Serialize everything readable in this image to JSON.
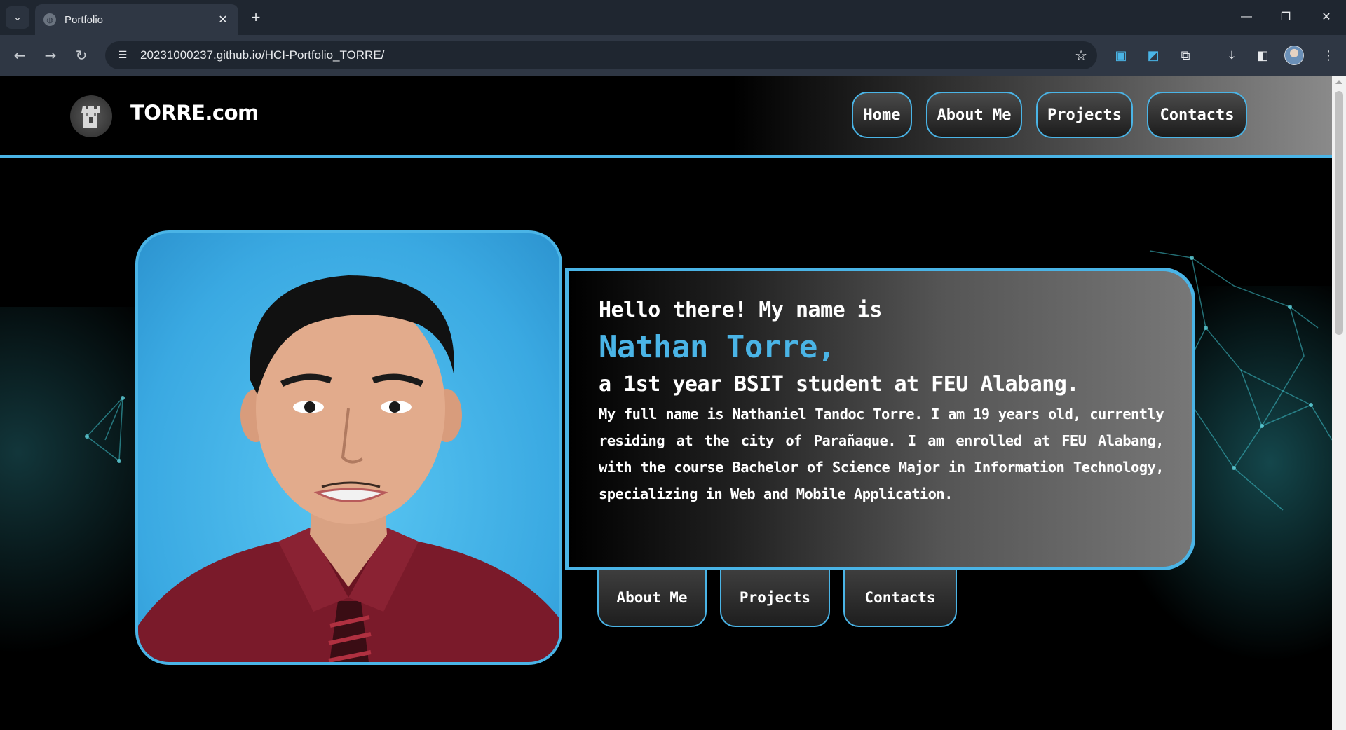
{
  "browser": {
    "tab_title": "Portfolio",
    "url": "20231000237.github.io/HCI-Portfolio_TORRE/"
  },
  "site": {
    "brand": "TORRE.com",
    "nav": [
      "Home",
      "About Me",
      "Projects",
      "Contacts"
    ]
  },
  "hero": {
    "greeting": "Hello there! My name is",
    "name": "Nathan Torre,",
    "tagline": "a 1st year BSIT student at FEU Alabang.",
    "bio": "My full name is Nathaniel Tandoc Torre. I am 19 years old, currently residing at the city of Parañaque. I am enrolled at FEU Alabang, with the course Bachelor of Science Major in Information Technology, specializing in Web and Mobile Application.",
    "buttons": [
      "About Me",
      "Projects",
      "Contacts"
    ]
  },
  "colors": {
    "accent": "#4ab4e6",
    "shirt": "#7a1a2a"
  }
}
